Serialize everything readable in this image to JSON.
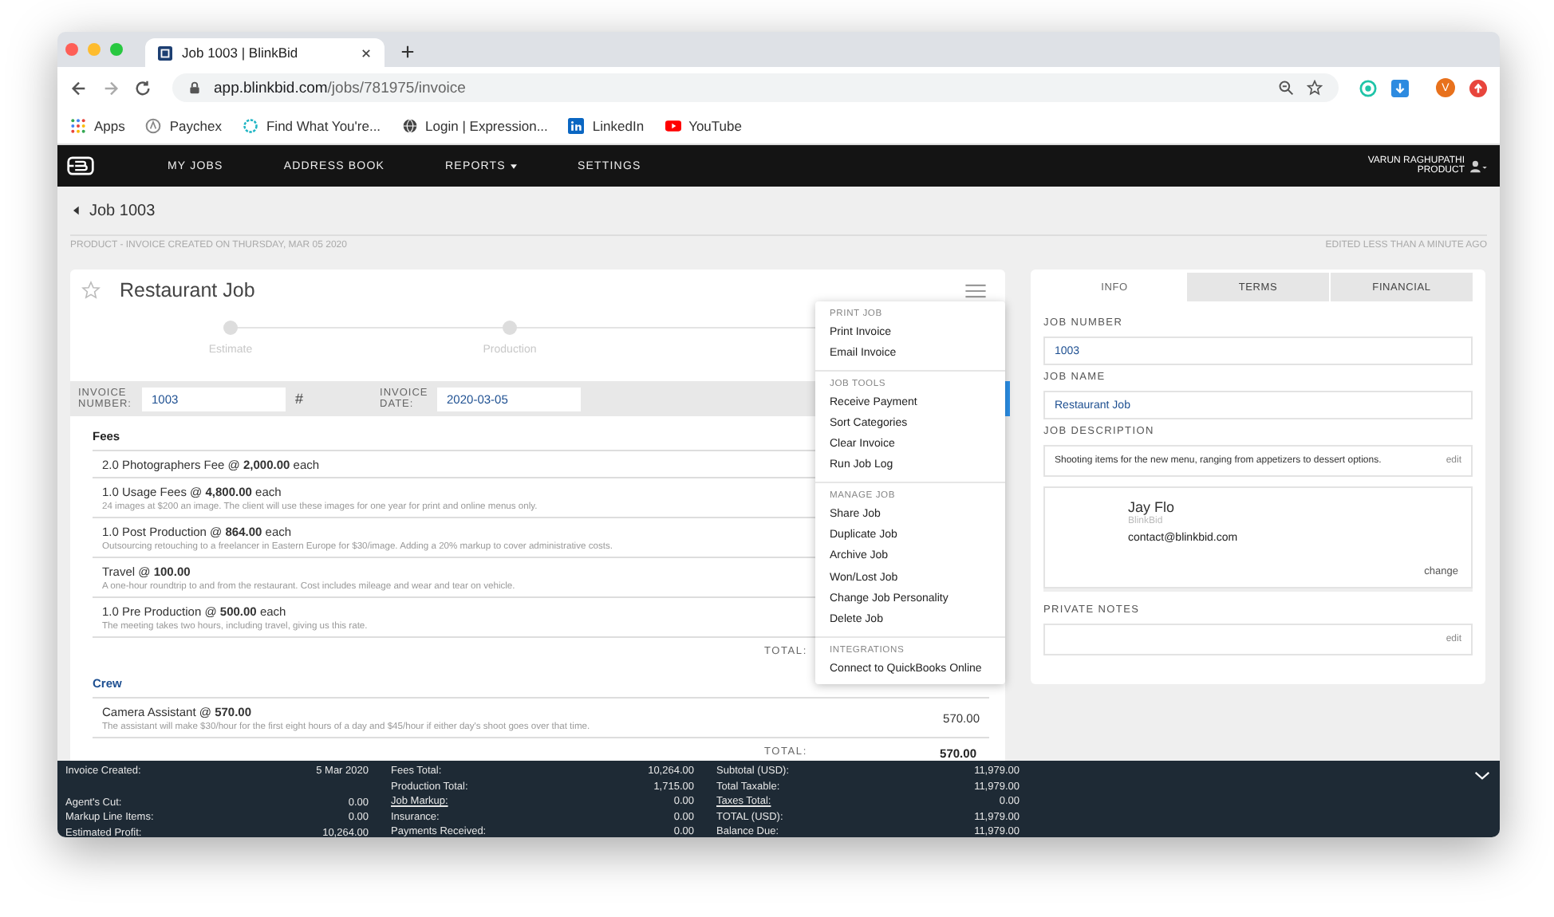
{
  "browser": {
    "tab_title": "Job 1003 | BlinkBid",
    "url_host": "app.blinkbid.com",
    "url_path": "/jobs/781975/invoice",
    "avatar_letter": "V",
    "bookmarks": [
      {
        "label": "Apps",
        "kind": "apps"
      },
      {
        "label": "Paychex",
        "kind": "paychex"
      },
      {
        "label": "Find What You're...",
        "kind": "find"
      },
      {
        "label": "Login | Expression...",
        "kind": "globe"
      },
      {
        "label": "LinkedIn",
        "kind": "linkedin"
      },
      {
        "label": "YouTube",
        "kind": "youtube"
      }
    ]
  },
  "nav": {
    "items": [
      {
        "label": "MY JOBS",
        "dropdown": false
      },
      {
        "label": "ADDRESS BOOK",
        "dropdown": false
      },
      {
        "label": "REPORTS",
        "dropdown": true
      },
      {
        "label": "SETTINGS",
        "dropdown": false
      }
    ],
    "user_name": "VARUN RAGHUPATHI",
    "user_role": "PRODUCT"
  },
  "breadcrumb": "Job 1003",
  "meta_left": "PRODUCT - INVOICE CREATED ON THURSDAY, MAR 05 2020",
  "meta_right": "EDITED LESS THAN A MINUTE AGO",
  "job": {
    "title": "Restaurant Job",
    "stages": [
      {
        "label": "Estimate"
      },
      {
        "label": "Production"
      }
    ],
    "invoice_number_label": "INVOICE NUMBER:",
    "invoice_number": "1003",
    "hash": "#",
    "invoice_date_label": "INVOICE DATE:",
    "invoice_date": "2020-03-05",
    "sections": [
      {
        "name": "Fees",
        "items": [
          {
            "title": "2.0 Photographers Fee @ **2,000.00** each"
          },
          {
            "title": "1.0 Usage Fees @ **4,800.00** each",
            "description": "24 images at $200 an image. The client will use these images for one year for print and online menus only."
          },
          {
            "title": "1.0 Post Production @ **864.00** each",
            "description": "Outsourcing retouching to a freelancer in Eastern Europe for $30/image. Adding a 20% markup to cover administrative costs."
          },
          {
            "title": "Travel @ **100.00**",
            "description": "A one-hour roundtrip to and from the restaurant. Cost includes mileage and wear and tear on vehicle."
          },
          {
            "title": "1.0 Pre Production @ **500.00** each",
            "description": "The meeting takes two hours, including travel, giving us this rate."
          }
        ],
        "total_label": "TOTAL:"
      },
      {
        "name": "Crew",
        "items": [
          {
            "title": "Camera Assistant @ **570.00**",
            "description": "The assistant will make $30/hour for the first eight hours of a day and $45/hour if either day's shoot goes over that time.",
            "amount": "570.00"
          }
        ],
        "total_label": "TOTAL:",
        "total": "570.00"
      }
    ]
  },
  "menu": [
    {
      "heading": "PRINT JOB",
      "items": [
        "Print Invoice",
        "Email Invoice"
      ]
    },
    {
      "heading": "JOB TOOLS",
      "items": [
        "Receive Payment",
        "Sort Categories",
        "Clear Invoice",
        "Run Job Log"
      ]
    },
    {
      "heading": "MANAGE JOB",
      "items": [
        "Share Job",
        "Duplicate Job",
        "Archive Job",
        "Won/Lost Job",
        "Change Job Personality",
        "Delete Job"
      ]
    },
    {
      "heading": "INTEGRATIONS",
      "items": [
        "Connect to QuickBooks Online"
      ]
    }
  ],
  "panel": {
    "tabs": [
      {
        "label": "INFO",
        "selected": true
      },
      {
        "label": "TERMS",
        "selected": false
      },
      {
        "label": "FINANCIAL",
        "selected": false
      }
    ],
    "job_number_label": "JOB NUMBER",
    "job_number": "1003",
    "job_name_label": "JOB NAME",
    "job_name": "Restaurant Job",
    "description_label": "JOB DESCRIPTION",
    "description": "Shooting items for the new menu, ranging from appetizers to dessert options.",
    "description_edit": "edit",
    "contact": {
      "name": "Jay Flo",
      "company": "BlinkBid",
      "email": "contact@blinkbid.com",
      "change": "change"
    },
    "notes_label": "PRIVATE NOTES",
    "notes_edit": "edit"
  },
  "summary": [
    [
      [
        {
          "label": "Invoice Created:",
          "value": "5 Mar 2020",
          "kind": "text"
        }
      ],
      [
        {
          "label": "Agent's Cut:",
          "value": "0.00",
          "kind": "text"
        },
        {
          "label": "Markup Line Items:",
          "value": "0.00",
          "kind": "text"
        },
        {
          "label": "Estimated Profit:",
          "value": "10,264.00",
          "kind": "text"
        }
      ]
    ],
    [
      [
        {
          "label": "Fees Total:",
          "value": "10,264.00",
          "kind": "text"
        },
        {
          "label": "Production Total:",
          "value": "1,715.00",
          "kind": "text"
        },
        {
          "label": "Job Markup:",
          "value": "0.00",
          "kind": "link"
        },
        {
          "label": "Insurance:",
          "value": "0.00",
          "kind": "text"
        },
        {
          "label": "Payments Received:",
          "value": "0.00",
          "kind": "text"
        }
      ]
    ],
    [
      [
        {
          "label": "Subtotal (USD):",
          "value": "11,979.00",
          "kind": "text"
        },
        {
          "label": "Total Taxable:",
          "value": "11,979.00",
          "kind": "text"
        },
        {
          "label": "Taxes Total:",
          "value": "0.00",
          "kind": "link"
        },
        {
          "label": "TOTAL (USD):",
          "value": "11,979.00",
          "kind": "text"
        },
        {
          "label": "Balance Due:",
          "value": "11,979.00",
          "kind": "text"
        }
      ]
    ]
  ]
}
